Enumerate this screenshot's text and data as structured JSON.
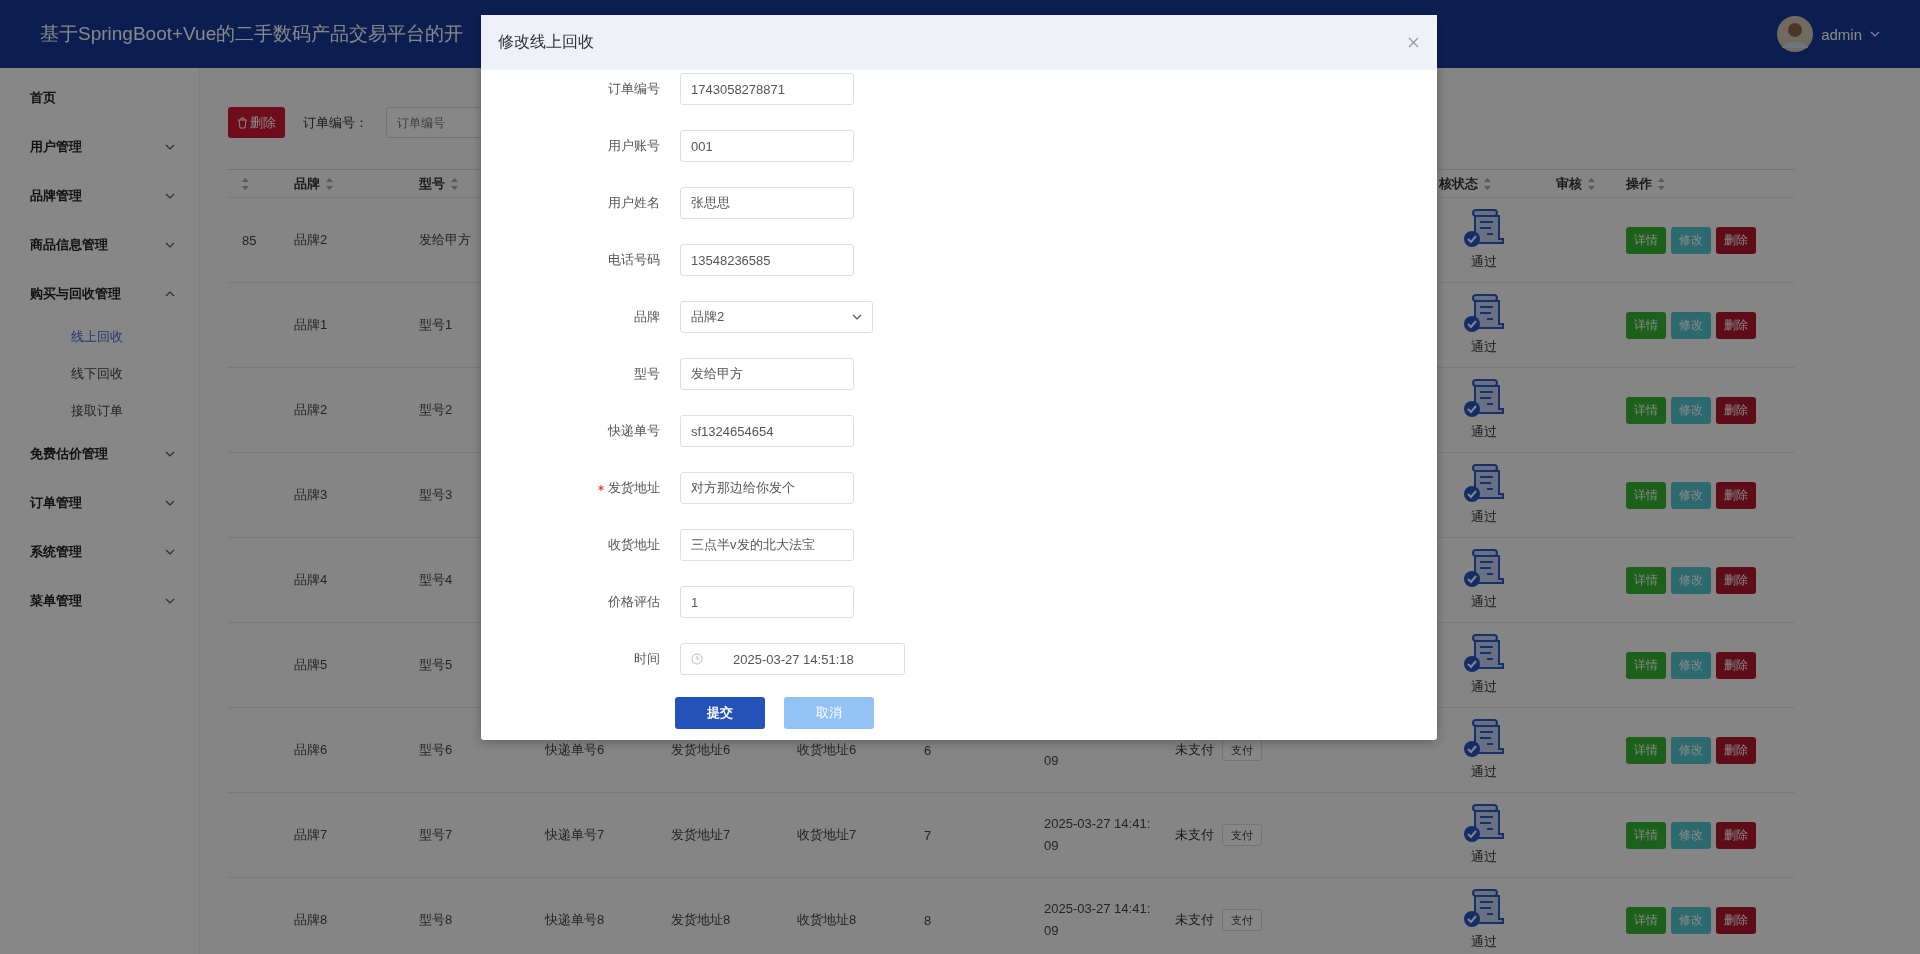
{
  "header": {
    "title": "基于SpringBoot+Vue的二手数码产品交易平台的开",
    "user": "admin"
  },
  "sidebar": {
    "items": [
      {
        "label": "首页",
        "selected": false
      },
      {
        "label": "用户管理",
        "selected": false,
        "expanded": false
      },
      {
        "label": "品牌管理",
        "selected": false,
        "expanded": false
      },
      {
        "label": "商品信息管理",
        "selected": false,
        "expanded": false
      },
      {
        "label": "购买与回收管理",
        "selected": false,
        "expanded": true,
        "children": [
          {
            "label": "线上回收",
            "selected": true
          },
          {
            "label": "线下回收",
            "selected": false
          },
          {
            "label": "接取订单",
            "selected": false
          }
        ]
      },
      {
        "label": "免费估价管理",
        "selected": false,
        "expanded": false
      },
      {
        "label": "订单管理",
        "selected": false,
        "expanded": false
      },
      {
        "label": "系统管理",
        "selected": false,
        "expanded": false
      },
      {
        "label": "菜单管理",
        "selected": false,
        "expanded": false
      }
    ]
  },
  "toolbar": {
    "delete_button": "删除",
    "search_label": "订单编号：",
    "search_placeholder": "订单编号"
  },
  "table": {
    "header": {
      "column_1_sort": true,
      "brand": "品牌",
      "model": "型号",
      "review_status": "核状态",
      "review": "审核",
      "actions": "操作"
    },
    "rows": [
      {
        "column_1": "85",
        "brand": "品牌2",
        "model": "发给甲方",
        "review_status": "通过",
        "actions": [
          "详情",
          "修改",
          "删除"
        ]
      },
      {
        "brand": "品牌1",
        "model": "型号1",
        "review_status": "通过",
        "actions": [
          "详情",
          "修改",
          "删除"
        ]
      },
      {
        "brand": "品牌2",
        "model": "型号2",
        "review_status": "通过",
        "actions": [
          "详情",
          "修改",
          "删除"
        ]
      },
      {
        "brand": "品牌3",
        "model": "型号3",
        "review_status": "通过",
        "actions": [
          "详情",
          "修改",
          "删除"
        ]
      },
      {
        "brand": "品牌4",
        "model": "型号4",
        "review_status": "通过",
        "actions": [
          "详情",
          "修改",
          "删除"
        ]
      },
      {
        "brand": "品牌5",
        "model": "型号5",
        "review_status": "通过",
        "actions": [
          "详情",
          "修改",
          "删除"
        ]
      },
      {
        "brand": "品牌6",
        "model": "型号6",
        "tracking": "快递单号6",
        "ship_address": "发货地址6",
        "receive_address": "收货地址6",
        "price": "6",
        "time_tail": "09",
        "pay_status": "未支付",
        "pay_button": "支付",
        "review_status": "通过",
        "actions": [
          "详情",
          "修改",
          "删除"
        ]
      },
      {
        "brand": "品牌7",
        "model": "型号7",
        "tracking": "快递单号7",
        "ship_address": "发货地址7",
        "receive_address": "收货地址7",
        "price": "7",
        "time": "2025-03-27 14:41:09",
        "pay_status": "未支付",
        "pay_button": "支付",
        "review_status": "通过",
        "actions": [
          "详情",
          "修改",
          "删除"
        ]
      },
      {
        "brand": "品牌8",
        "model": "型号8",
        "tracking": "快递单号8",
        "ship_address": "发货地址8",
        "receive_address": "收货地址8",
        "price": "8",
        "time": "2025-03-27 14:41:09",
        "pay_status": "未支付",
        "pay_button": "支付",
        "review_status": "通过",
        "actions": [
          "详情",
          "修改",
          "删除"
        ]
      }
    ]
  },
  "dialog": {
    "title": "修改线上回收",
    "fields": [
      {
        "label": "订单编号",
        "kind": "text",
        "value": "1743058278871",
        "required": false
      },
      {
        "label": "用户账号",
        "kind": "text",
        "value": "001",
        "required": false
      },
      {
        "label": "用户姓名",
        "kind": "text",
        "value": "张思思",
        "required": false
      },
      {
        "label": "电话号码",
        "kind": "text",
        "value": "13548236585",
        "required": false
      },
      {
        "label": "品牌",
        "kind": "select",
        "value": "品牌2",
        "required": false
      },
      {
        "label": "型号",
        "kind": "text",
        "value": "发给甲方",
        "required": false
      },
      {
        "label": "快递单号",
        "kind": "text",
        "value": "sf1324654654",
        "required": false
      },
      {
        "label": "发货地址",
        "kind": "text",
        "value": "对方那边给你发个",
        "required": true
      },
      {
        "label": "收货地址",
        "kind": "text",
        "value": "三点半v发的北大法宝",
        "required": false
      },
      {
        "label": "价格评估",
        "kind": "text",
        "value": "1",
        "required": false
      },
      {
        "label": "时间",
        "kind": "date",
        "value": "2025-03-27 14:51:18",
        "required": false
      }
    ],
    "buttons": {
      "submit": "提交",
      "cancel": "取消"
    }
  }
}
